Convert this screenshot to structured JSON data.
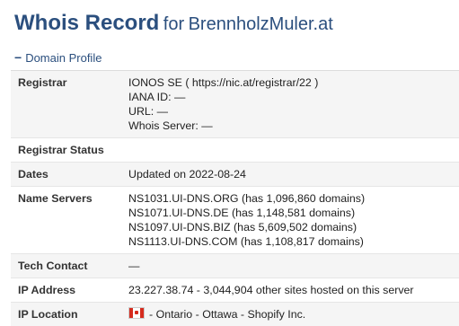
{
  "header": {
    "title": "Whois Record",
    "for_word": "for",
    "domain": "BrennholzMuler.at"
  },
  "section": {
    "label": "Domain Profile"
  },
  "rows": {
    "registrar": {
      "label": "Registrar",
      "lines": [
        "IONOS SE ( https://nic.at/registrar/22 )",
        "IANA ID: —",
        "URL: —",
        "Whois Server: —"
      ]
    },
    "registrar_status": {
      "label": "Registrar Status",
      "value": ""
    },
    "dates": {
      "label": "Dates",
      "value": "Updated on 2022-08-24"
    },
    "name_servers": {
      "label": "Name Servers",
      "lines": [
        "NS1031.UI-DNS.ORG (has 1,096,860 domains)",
        "NS1071.UI-DNS.DE (has 1,148,581 domains)",
        "NS1097.UI-DNS.BIZ (has 5,609,502 domains)",
        "NS1113.UI-DNS.COM (has 1,108,817 domains)"
      ]
    },
    "tech_contact": {
      "label": "Tech Contact",
      "value": "—"
    },
    "ip_address": {
      "label": "IP Address",
      "value": "23.227.38.74 - 3,044,904 other sites hosted on this server"
    },
    "ip_location": {
      "label": "IP Location",
      "flag": "canada-flag-icon",
      "value": "- Ontario - Ottawa - Shopify Inc."
    }
  }
}
